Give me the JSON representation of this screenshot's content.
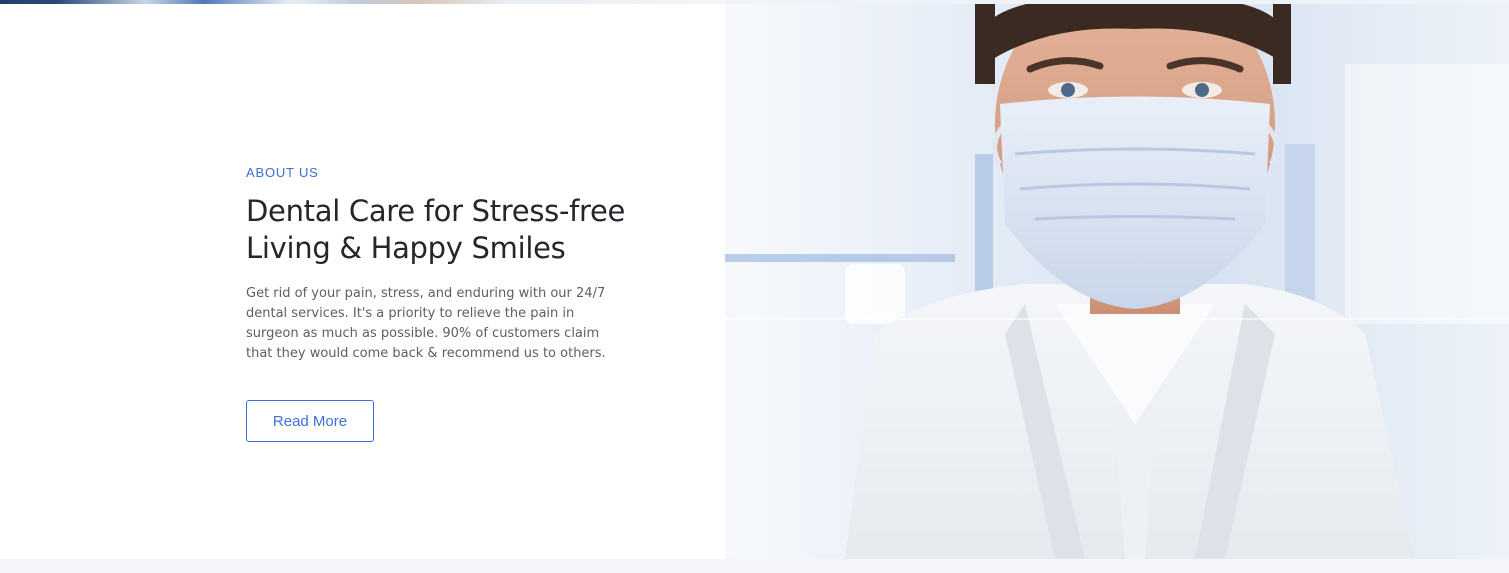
{
  "about": {
    "eyebrow": "ABOUT US",
    "headline_line1": "Dental Care for Stress-free",
    "headline_line2": "Living & Happy Smiles",
    "body": "Get rid of your pain, stress, and enduring with our 24/7 dental services. It's a priority to relieve the pain in surgeon as much as possible. 90% of customers claim that they would come back & recommend us to others.",
    "button_label": "Read More"
  },
  "colors": {
    "accent": "#3f6fd8",
    "heading": "#23262b",
    "body": "#5b5f66"
  }
}
